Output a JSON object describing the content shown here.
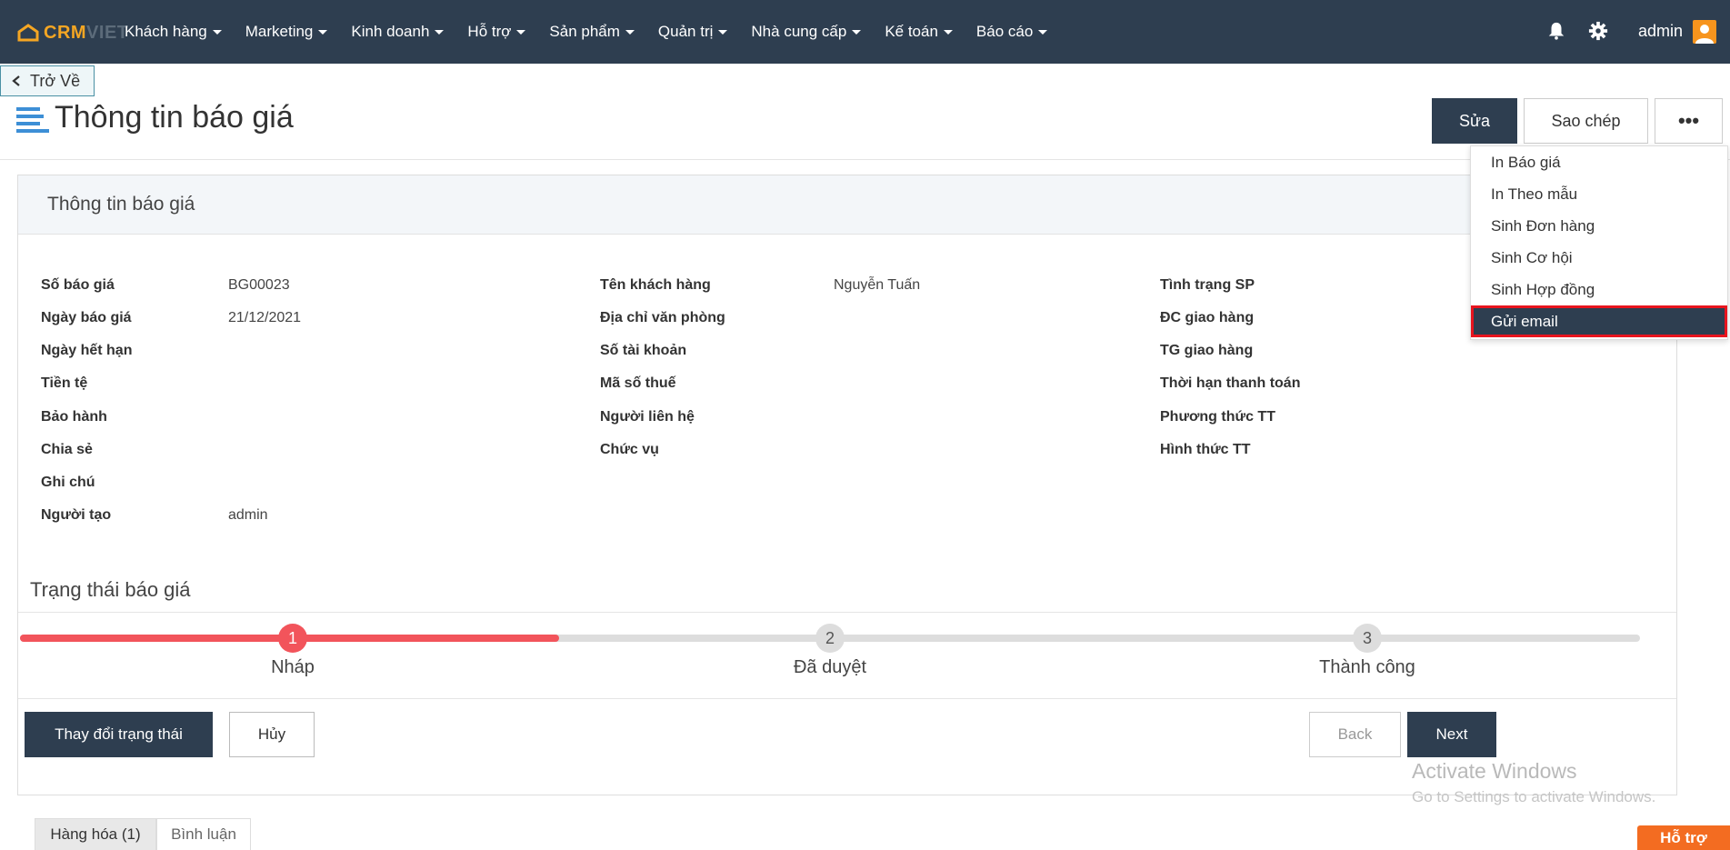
{
  "nav": {
    "logo_crm": "CRM",
    "logo_viet": "VIET",
    "menu": [
      {
        "label": "Khách hàng"
      },
      {
        "label": "Marketing"
      },
      {
        "label": "Kinh doanh"
      },
      {
        "label": "Hỗ trợ"
      },
      {
        "label": "Sản phẩm"
      },
      {
        "label": "Quản trị"
      },
      {
        "label": "Nhà cung cấp"
      },
      {
        "label": "Kế toán"
      },
      {
        "label": "Báo cáo"
      }
    ],
    "user_name": "admin",
    "icons": {
      "notification": "bell-icon",
      "settings": "gear-icon",
      "user": "avatar-icon"
    }
  },
  "back_label": "Trở Về",
  "page_title": "Thông tin báo giá",
  "actions": {
    "edit": "Sửa",
    "copy": "Sao chép",
    "more": "•••"
  },
  "dropdown": {
    "items": [
      {
        "label": "In Báo giá"
      },
      {
        "label": "In Theo mẫu"
      },
      {
        "label": "Sinh Đơn hàng"
      },
      {
        "label": "Sinh Cơ hội"
      },
      {
        "label": "Sinh Hợp đồng"
      },
      {
        "label": "Gửi email",
        "highlighted": true
      }
    ]
  },
  "card": {
    "title": "Thông tin báo giá",
    "col1": [
      {
        "label": "Số báo giá",
        "value": "BG00023"
      },
      {
        "label": "Ngày báo giá",
        "value": "21/12/2021"
      },
      {
        "label": "Ngày hết hạn",
        "value": ""
      },
      {
        "label": "Tiền tệ",
        "value": ""
      },
      {
        "label": "Bảo hành",
        "value": ""
      },
      {
        "label": "Chia sẻ",
        "value": ""
      },
      {
        "label": "Ghi chú",
        "value": ""
      },
      {
        "label": "Người tạo",
        "value": "admin"
      }
    ],
    "col2": [
      {
        "label": "Tên khách hàng",
        "value": "Nguyễn Tuấn"
      },
      {
        "label": "Địa chỉ văn phòng",
        "value": ""
      },
      {
        "label": "Số tài khoản",
        "value": ""
      },
      {
        "label": "Mã số thuế",
        "value": ""
      },
      {
        "label": "Người liên hệ",
        "value": ""
      },
      {
        "label": "Chức vụ",
        "value": ""
      }
    ],
    "col3": [
      {
        "label": "Tình trạng SP",
        "value": ""
      },
      {
        "label": "ĐC giao hàng",
        "value": ""
      },
      {
        "label": "TG giao hàng",
        "value": ""
      },
      {
        "label": "Thời hạn thanh toán",
        "value": ""
      },
      {
        "label": "Phương thức TT",
        "value": ""
      },
      {
        "label": "Hình thức TT",
        "value": ""
      }
    ]
  },
  "status": {
    "title": "Trạng thái báo giá",
    "progress": 0.333,
    "steps": [
      {
        "number": "1",
        "label": "Nháp",
        "done": true
      },
      {
        "number": "2",
        "label": "Đã duyệt",
        "done": false
      },
      {
        "number": "3",
        "label": "Thành công",
        "done": false
      }
    ],
    "buttons": {
      "change": "Thay đổi trạng thái",
      "cancel": "Hủy",
      "back": "Back",
      "next": "Next"
    }
  },
  "watermark": {
    "line1": "Activate Windows",
    "line2": "Go to Settings to activate Windows."
  },
  "tabs": [
    {
      "label": "Hàng hóa (1)",
      "active": true
    },
    {
      "label": "Bình luận",
      "active": false
    }
  ],
  "support_label": "Hỗ trợ",
  "colors": {
    "nav_bg": "#2e3e50",
    "accent_orange": "#f5a623",
    "progress_red": "#f2545b",
    "highlight_border": "#e8141e"
  }
}
